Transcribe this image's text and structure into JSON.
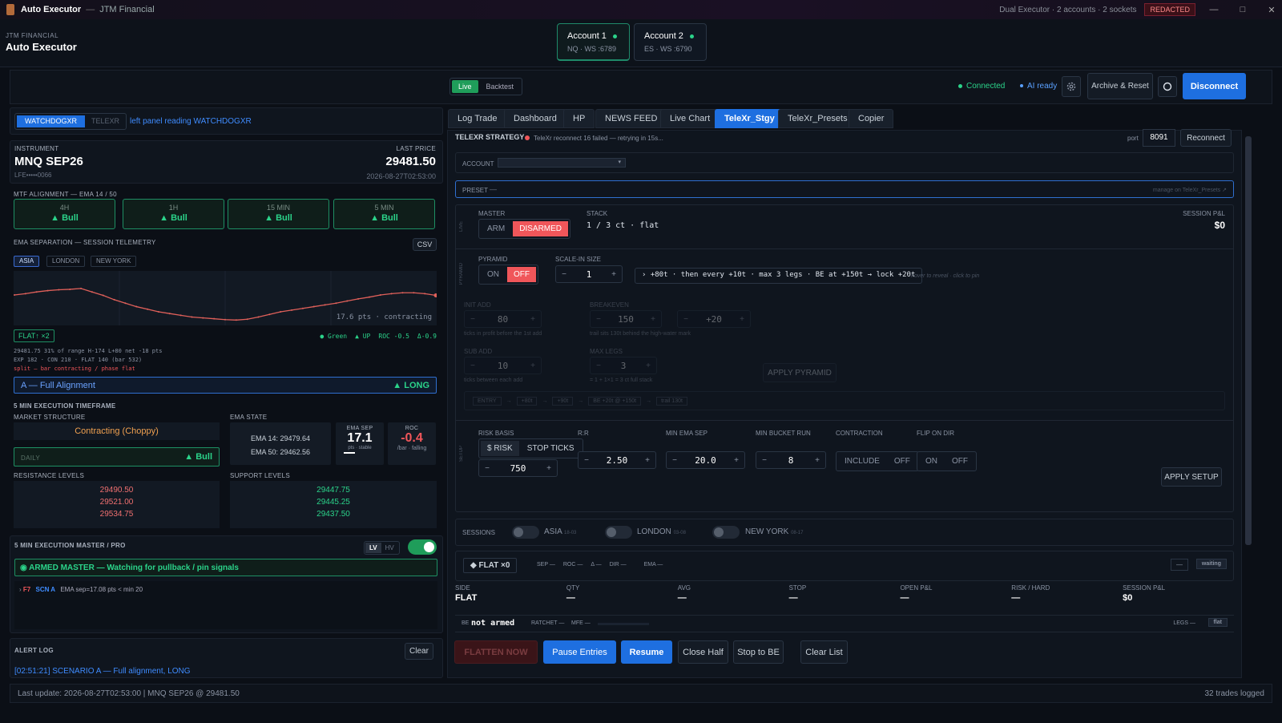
{
  "titlebar": {
    "app": "Auto Executor",
    "sep": "—",
    "org": "JTM Financial",
    "info": "Dual Executor · 2 accounts · 2 sockets",
    "badge": "REDACTED",
    "min": "—",
    "max": "□",
    "close": "✕"
  },
  "header": {
    "org_small": "JTM FINANCIAL",
    "title": "Auto Executor",
    "accounts": [
      {
        "name": "Account 1",
        "sub": "NQ · WS :6789"
      },
      {
        "name": "Account 2",
        "sub": "ES · WS :6790"
      }
    ]
  },
  "toolbar": {
    "live": "Live",
    "backtest": "Backtest",
    "connected": "Connected",
    "ai": "AI ready",
    "archive": "Archive & Reset",
    "disconnect": "Disconnect"
  },
  "left": {
    "source_tabs": [
      "WATCHDOGXR",
      "TELEXR"
    ],
    "source_note": "left panel reading WATCHDOGXR",
    "instrument_label": "INSTRUMENT",
    "instrument": "MNQ SEP26",
    "account_masked": "LFE•••••0066",
    "last_price_label": "LAST PRICE",
    "last_price": "29481.50",
    "timestamp": "2026-08-27T02:53:00",
    "mtf_label": "MTF ALIGNMENT — EMA 14 / 50",
    "mtf": [
      {
        "tf": "4H",
        "val": "▲ Bull"
      },
      {
        "tf": "1H",
        "val": "▲ Bull"
      },
      {
        "tf": "15 MIN",
        "val": "▲ Bull"
      },
      {
        "tf": "5 MIN",
        "val": "▲ Bull"
      }
    ],
    "ema_sep_label": "EMA SEPARATION — SESSION TELEMETRY",
    "csv": "CSV",
    "sessions": [
      "ASIA",
      "LONDON",
      "NEW YORK"
    ],
    "spark_note": "17.6 pts · contracting",
    "spark_values": [
      0.63,
      0.66,
      0.7,
      0.73,
      0.75,
      0.76,
      0.78,
      0.7,
      0.62,
      0.52,
      0.44,
      0.36,
      0.3,
      0.24,
      0.2,
      0.16,
      0.12,
      0.1,
      0.08,
      0.06,
      0.05,
      0.07,
      0.12,
      0.18,
      0.24,
      0.28,
      0.32,
      0.36,
      0.4,
      0.44,
      0.49,
      0.54,
      0.58,
      0.63,
      0.66,
      0.68,
      0.68,
      0.66,
      0.62
    ],
    "flat_badge": "FLAT↑ ×2",
    "green_note": "● Green",
    "up_note": "▲ UP",
    "roc_note": "ROC -0.5",
    "delta_note": "Δ-0.9",
    "tele1": "29481.75   31% of range   H-174  L+80   net -18 pts",
    "tele2": "EXP 182 · CON 210 · FLAT 140   (bar 532)",
    "tele3": "split — bar contracting / phase flat",
    "alignment": "A — Full Alignment",
    "alignment_dir": "▲ LONG",
    "exec_tf_label": "5 MIN EXECUTION TIMEFRAME",
    "ms_label": "MARKET STRUCTURE",
    "ms_val": "Contracting (Choppy)",
    "daily_label": "DAILY",
    "daily_val": "▲ Bull",
    "ema_state_label": "EMA STATE",
    "ema14": "EMA 14:  29479.64",
    "ema50": "EMA 50:  29462.56",
    "ema_sep_box_label": "EMA SEP",
    "ema_sep_val": "17.1",
    "ema_sep_sub": "pts · stable",
    "roc_label": "ROC",
    "roc_val": "-0.4",
    "roc_sub": "/bar · falling",
    "res_label": "RESISTANCE LEVELS",
    "res": [
      "29490.50",
      "29521.00",
      "29534.75"
    ],
    "sup_label": "SUPPORT LEVELS",
    "sup": [
      "29447.75",
      "29445.25",
      "29437.50"
    ],
    "master_label": "5 MIN EXECUTION MASTER / PRO",
    "lv": "LV",
    "hv": "HV",
    "armed": "◉ ARMED MASTER — Watching for pullback / pin signals",
    "log_row": {
      "arrow": "›",
      "key": "F7",
      "scn": "SCN A",
      "msg": "EMA sep=17.08 pts < min 20"
    },
    "alert_label": "ALERT LOG",
    "clear": "Clear",
    "alert": "[02:51:21]  SCENARIO A — Full alignment, LONG"
  },
  "right": {
    "tabs": [
      "Log Trade",
      "Dashboard",
      "HP",
      "NEWS FEED",
      "Live Chart",
      "TeleXr_Stgy",
      "TeleXr_Presets",
      "Copier"
    ],
    "strategy_title": "TELEXR STRATEGY",
    "reconnect_note": "TeleXr reconnect 16 failed — retrying in 15s...",
    "port_label": "port",
    "port": "8091",
    "reconnect": "Reconnect",
    "account_label": "ACCOUNT",
    "account_select": "▾",
    "preset_label": "PRESET",
    "preset_val": "—",
    "preset_link": "manage on TeleXr_Presets ↗",
    "live_side": "LIVE",
    "master_label": "MASTER",
    "arm": "ARM",
    "disarmed": "DISARMED",
    "stack_label": "STACK",
    "stack_val": "1 / 3 ct · flat",
    "session_pnl_label": "SESSION P&L",
    "session_pnl": "$0",
    "pyr_side": "PYRAMID",
    "pyramid_label": "PYRAMID",
    "on": "ON",
    "off": "OFF",
    "scale_label": "SCALE-IN SIZE",
    "scale_val": "1",
    "minus": "−",
    "plus": "+",
    "pyr_desc": "› +80t · then every +10t · max 3 legs · BE at +150t → lock +20t",
    "pyr_hint": "hover to reveal · click to pin",
    "init_add_label": "INIT ADD",
    "init_add": "80",
    "init_add_hint": "ticks in profit before the 1st add",
    "be_label": "BREAKEVEN",
    "be": "150",
    "be_lock": "+20",
    "be_hint": "trail sits 130t behind the high-water mark",
    "sub_add_label": "SUB ADD",
    "sub_add": "10",
    "sub_add_hint": "ticks between each add",
    "max_legs_label": "MAX LEGS",
    "max_legs": "3",
    "max_legs_hint": "= 1 + 1×1 = 3 ct full stack",
    "apply_pyramid": "APPLY PYRAMID",
    "chain": [
      "ENTRY",
      "+80t",
      "+90t",
      "BE +20t @ +150t",
      "trail 130t"
    ],
    "setup_side": "SETUP",
    "risk_basis_label": "RISK BASIS",
    "risk_opt1": "$ RISK",
    "risk_opt2": "STOP TICKS",
    "risk_val": "750",
    "rr_label": "R:R",
    "rr_val": "2.50",
    "min_ema_label": "MIN EMA SEP",
    "min_ema_val": "20.0",
    "min_bucket_label": "MIN BUCKET RUN",
    "min_bucket_val": "8",
    "contraction_label": "CONTRACTION",
    "include": "INCLUDE",
    "cont_off": "OFF",
    "flip_label": "FLIP ON DIR",
    "flip_on": "ON",
    "flip_off": "OFF",
    "apply_setup": "APPLY SETUP",
    "sessions_label": "SESSIONS",
    "sess": [
      {
        "name": "ASIA",
        "time": "18-03"
      },
      {
        "name": "LONDON",
        "time": "03-08"
      },
      {
        "name": "NEW YORK",
        "time": "08-17"
      }
    ],
    "flat_badge": "◆ FLAT ×0",
    "sep": "SEP —",
    "roc": "ROC —",
    "delta": "Δ —",
    "dir": "DIR —",
    "ema": "EMA —",
    "dash": "—",
    "waiting": "waiting",
    "pos": [
      {
        "l": "SIDE",
        "v": "FLAT"
      },
      {
        "l": "QTY",
        "v": "—"
      },
      {
        "l": "AVG",
        "v": "—"
      },
      {
        "l": "STOP",
        "v": "—"
      },
      {
        "l": "OPEN P&L",
        "v": "—"
      },
      {
        "l": "RISK / HARD",
        "v": "—"
      },
      {
        "l": "SESSION P&L",
        "v": "$0"
      }
    ],
    "be_small": "BE",
    "be_state": "not armed",
    "ratchet": "RATCHET —",
    "mfe": "MFE —",
    "legs": "LEGS —",
    "legs_flat": "flat",
    "flatten": "FLATTEN NOW",
    "pause": "Pause Entries",
    "resume": "Resume",
    "close_half": "Close Half",
    "stop_be": "Stop to BE",
    "clear_list": "Clear List"
  },
  "status": {
    "left": "Last update: 2026-08-27T02:53:00 | MNQ SEP26 @ 29481.50",
    "right": "32 trades logged"
  }
}
